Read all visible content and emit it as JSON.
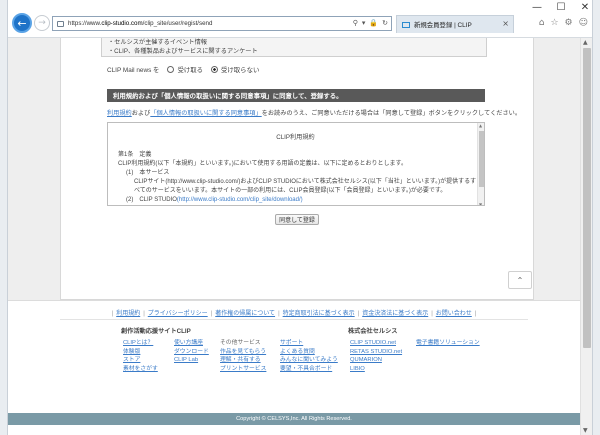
{
  "browser": {
    "url_prefix": "https://www.",
    "url_host": "clip-studio.com",
    "url_path": "/clip_site/user/regist/send",
    "tab_title": "新規会員登録 | CLIP",
    "window_controls": [
      "—",
      "☐",
      "✕"
    ],
    "tool_icons": [
      "⌂",
      "☆",
      "⚙",
      "☺"
    ]
  },
  "notice": {
    "lines": [
      "・セルシスが主催するイベント情報",
      "・CLIP、各種製品およびサービスに関するアンケート"
    ]
  },
  "mail": {
    "label": "CLIP Mail news を",
    "option_receive": "受け取る",
    "option_decline": "受け取らない"
  },
  "agree_bar": "利用規約および「個人情報の取扱いに関する同意事項」に同意して、登録する。",
  "lead": {
    "link1": "利用規約",
    "text1": "および",
    "link2": "「個人情報の取扱いに関する同意事項」",
    "text2": "をお読みのうえ、ご同意いただける場合は「同意して登録」ボタンをクリックしてください。"
  },
  "terms": {
    "title": "CLIP利用規約",
    "section": "第1条　定義",
    "intro": "CLIP利用規約(以下「本規約」といいます。)において使用する用語の定義は、以下に定めるとおりとします。",
    "item1_head": "(1)　本サービス",
    "item1_line1": "CLIPサイト(http://www.clip-studio.com/)およびCLIP STUDIOにおいて株式会社セルシス(以下「当社」といいます。)が提供するす",
    "item1_line2": "べてのサービスをいいます。本サイトの一部の利用には、CLIP会員登録(以下「会員登録」といいます。)が必要です。",
    "item2_head": "(2)　CLIP STUDIO",
    "item2_link": "(http://www.clip-studio.com/clip_site/download/)"
  },
  "agree_button": "同意して登録",
  "footer": {
    "links": [
      "利用規約",
      "プライバシーポリシー",
      "著作権の帰属について",
      "特定商取引法に基づく表示",
      "資金決済法に基づく表示",
      "お問い合わせ"
    ],
    "col_head_site": "創作活動応援サイトCLIP",
    "col_head_company": "株式会社セルシス",
    "col1": [
      "CLIPとは？",
      "体験版",
      "ストア",
      "素材をさがす"
    ],
    "col2": [
      "使い方講座",
      "ダウンロード",
      "CLIP Lab"
    ],
    "col3_head": "その他サービス",
    "col3": [
      "作品を見てもらう",
      "理解・共有する",
      "プリントサービス"
    ],
    "col4": [
      "サポート",
      "よくある質問",
      "みんなに聞いてみよう",
      "要望・不具合ボード"
    ],
    "col5": [
      "CLIP STUDIO.net",
      "RETAS STUDIO.net",
      "QUMARION",
      "LIBIO"
    ],
    "col6": [
      "電子書籍ソリューション"
    ],
    "copyright": "Copyright © CELSYS,Inc.  All Rights Reserved."
  }
}
